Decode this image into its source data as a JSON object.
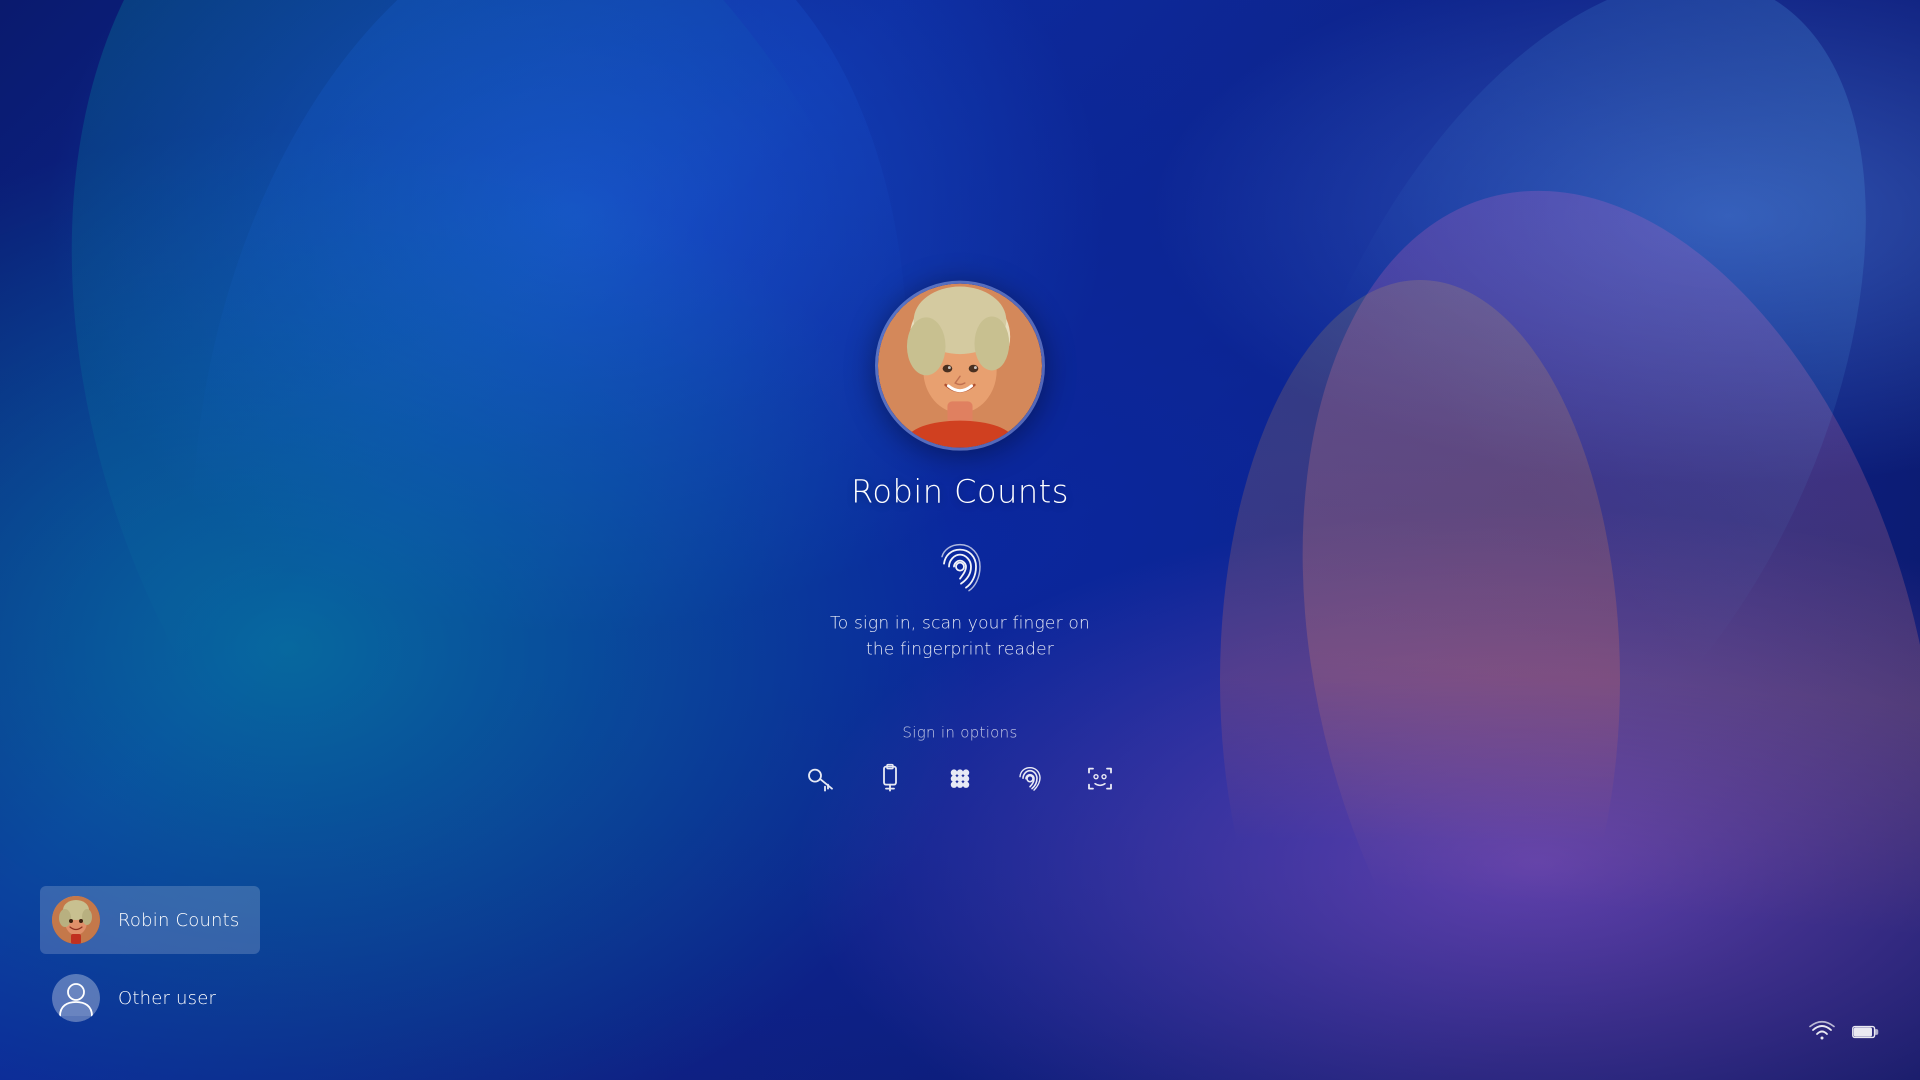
{
  "background": {
    "base_color": "#0d2080"
  },
  "login": {
    "user_name": "Robin Counts",
    "fingerprint_hint_line1": "To sign in, scan your finger on",
    "fingerprint_hint_line2": "the fingerprint reader",
    "signin_options_label": "Sign in options"
  },
  "signin_options": [
    {
      "id": "key",
      "label": "Key / Password",
      "icon": "key-icon"
    },
    {
      "id": "usb",
      "label": "USB Key",
      "icon": "usb-key-icon"
    },
    {
      "id": "pin",
      "label": "PIN",
      "icon": "pin-icon"
    },
    {
      "id": "fingerprint",
      "label": "Fingerprint",
      "icon": "fingerprint-icon",
      "active": true
    },
    {
      "id": "face",
      "label": "Face recognition",
      "icon": "face-icon"
    }
  ],
  "users": [
    {
      "id": "robin",
      "name": "Robin Counts",
      "active": true
    },
    {
      "id": "other",
      "name": "Other user",
      "active": false
    }
  ],
  "system_tray": {
    "wifi_icon": "wifi-icon",
    "battery_icon": "battery-icon"
  }
}
